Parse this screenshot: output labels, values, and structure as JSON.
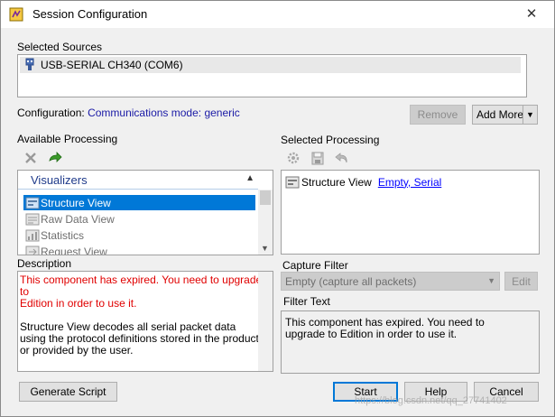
{
  "window": {
    "title": "Session Configuration",
    "close_glyph": "✕"
  },
  "sources": {
    "label": "Selected Sources",
    "items": [
      {
        "icon": "usb-serial-icon",
        "text": "USB-SERIAL CH340 (COM6)"
      }
    ]
  },
  "configuration": {
    "label": "Configuration:",
    "value": "Communications mode: generic",
    "remove_label": "Remove",
    "add_more_label": "Add More",
    "dropdown_glyph": "▼"
  },
  "available_processing": {
    "label": "Available Processing",
    "tool_icons": [
      "delete-icon",
      "add-arrow-icon"
    ],
    "group_header": "Visualizers",
    "group_chevron": "▲",
    "items": [
      "Structure View",
      "Raw Data View",
      "Statistics",
      "Request View"
    ],
    "selected_index": 0,
    "scroll_down_glyph": "▼"
  },
  "selected_processing": {
    "label": "Selected Processing",
    "tool_icons": [
      "settings-icon",
      "save-icon",
      "undo-icon"
    ],
    "items": [
      {
        "name": "Structure View",
        "link": "Empty, Serial"
      }
    ]
  },
  "description": {
    "label": "Description",
    "expired_line1": "This component has expired. You need to upgrade to",
    "expired_line2": "Edition in order to use it.",
    "body": "Structure View decodes all serial packet data using the protocol definitions stored in the product or provided by the user."
  },
  "capture_filter": {
    "label": "Capture Filter",
    "placeholder": "Empty (capture all packets)",
    "edit_label": "Edit"
  },
  "filter_text": {
    "label": "Filter Text",
    "text": "This component has expired. You need to upgrade to Edition in order to use it."
  },
  "footer": {
    "generate_label": "Generate Script",
    "start_label": "Start",
    "help_label": "Help",
    "cancel_label": "Cancel",
    "watermark": "https://blog.csdn.net/qq_27741402"
  },
  "colors": {
    "selection": "#0078d7",
    "link": "#0000ff",
    "config_value": "#1a1aa6",
    "expired": "#e00000"
  }
}
